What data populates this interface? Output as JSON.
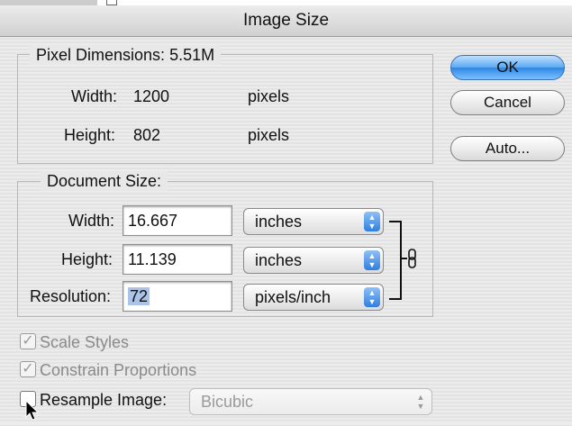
{
  "window": {
    "title": "Image Size"
  },
  "pixel_dimensions": {
    "legend": "Pixel Dimensions:",
    "size": "5.51M",
    "width_label": "Width:",
    "width_value": "1200",
    "width_unit": "pixels",
    "height_label": "Height:",
    "height_value": "802",
    "height_unit": "pixels"
  },
  "document_size": {
    "legend": "Document Size:",
    "width_label": "Width:",
    "width_value": "16.667",
    "width_unit": "inches",
    "height_label": "Height:",
    "height_value": "11.139",
    "height_unit": "inches",
    "resolution_label": "Resolution:",
    "resolution_value": "72",
    "resolution_unit": "pixels/inch"
  },
  "buttons": {
    "ok": "OK",
    "cancel": "Cancel",
    "auto": "Auto..."
  },
  "options": {
    "scale_styles": "Scale Styles",
    "constrain_proportions": "Constrain Proportions",
    "resample_image": "Resample Image:",
    "resample_method": "Bicubic"
  },
  "colors": {
    "accent": "#2d86e6",
    "selection": "#a9c4e8"
  },
  "icons": {
    "link": "chain-link-icon",
    "checkmark": "checkmark-icon",
    "popup_arrows": "updown-arrows-icon",
    "cursor": "mouse-pointer-icon"
  }
}
